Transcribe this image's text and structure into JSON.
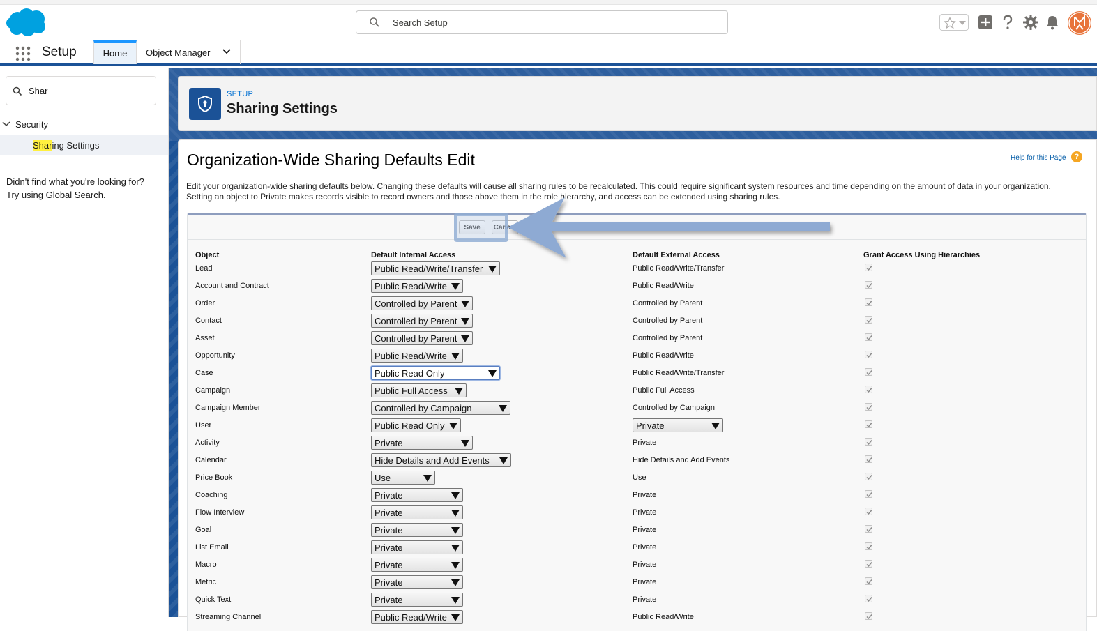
{
  "header": {
    "search_placeholder": "Search Setup"
  },
  "context": {
    "app_name": "Setup",
    "tabs": [
      {
        "label": "Home"
      },
      {
        "label": "Object Manager"
      }
    ]
  },
  "sidebar": {
    "quick_find_value": "Shar",
    "group_label": "Security",
    "item_highlight": "Shar",
    "item_rest": "ing Settings",
    "not_found_line1": "Didn't find what you're looking for?",
    "not_found_line2": "Try using Global Search."
  },
  "page_header": {
    "eyebrow": "SETUP",
    "title": "Sharing Settings"
  },
  "content": {
    "title": "Organization-Wide Sharing Defaults Edit",
    "help_label": "Help for this Page",
    "help_glyph": "?",
    "description_line1": "Edit your organization-wide sharing defaults below. Changing these defaults will cause all sharing rules to be recalculated. This could require significant system resources and time depending on the amount of data in your organization.",
    "description_line2": "Setting an object to Private makes records visible to record owners and those above them in the role hierarchy, and access can be extended using sharing rules.",
    "save_label": "Save",
    "cancel_label": "Cancel"
  },
  "table": {
    "headers": [
      "Object",
      "Default Internal Access",
      "Default External Access",
      "Grant Access Using Hierarchies"
    ],
    "rows": [
      {
        "object": "Lead",
        "internal": "Public Read/Write/Transfer",
        "external": "Public Read/Write/Transfer"
      },
      {
        "object": "Account and Contract",
        "internal": "Public Read/Write",
        "external": "Public Read/Write"
      },
      {
        "object": "Order",
        "internal": "Controlled by Parent",
        "external": "Controlled by Parent"
      },
      {
        "object": "Contact",
        "internal": "Controlled by Parent",
        "external": "Controlled by Parent"
      },
      {
        "object": "Asset",
        "internal": "Controlled by Parent",
        "external": "Controlled by Parent"
      },
      {
        "object": "Opportunity",
        "internal": "Public Read/Write",
        "external": "Public Read/Write"
      },
      {
        "object": "Case",
        "internal": "Public Read Only",
        "external": "Public Read/Write/Transfer"
      },
      {
        "object": "Campaign",
        "internal": "Public Full Access",
        "external": "Public Full Access"
      },
      {
        "object": "Campaign Member",
        "internal": "Controlled by Campaign",
        "external": "Controlled by Campaign"
      },
      {
        "object": "User",
        "internal": "Public Read Only",
        "external": "Private"
      },
      {
        "object": "Activity",
        "internal": "Private",
        "external": "Private"
      },
      {
        "object": "Calendar",
        "internal": "Hide Details and Add Events",
        "external": "Hide Details and Add Events"
      },
      {
        "object": "Price Book",
        "internal": "Use",
        "external": "Use"
      },
      {
        "object": "Coaching",
        "internal": "Private",
        "external": "Private"
      },
      {
        "object": "Flow Interview",
        "internal": "Private",
        "external": "Private"
      },
      {
        "object": "Goal",
        "internal": "Private",
        "external": "Private"
      },
      {
        "object": "List Email",
        "internal": "Private",
        "external": "Private"
      },
      {
        "object": "Macro",
        "internal": "Private",
        "external": "Private"
      },
      {
        "object": "Metric",
        "internal": "Private",
        "external": "Private"
      },
      {
        "object": "Quick Text",
        "internal": "Private",
        "external": "Private"
      },
      {
        "object": "Streaming Channel",
        "internal": "Public Read/Write",
        "external": "Public Read/Write"
      }
    ]
  },
  "colors": {
    "brand_blue": "#1b5297",
    "link_blue": "#0070d2",
    "salesforce_cloud": "#00a1e0",
    "avatar_orange": "#e8743b",
    "annotation_arrow": "#8eaad3"
  }
}
